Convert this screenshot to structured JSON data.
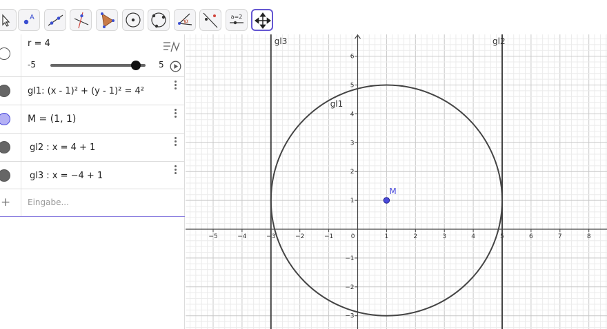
{
  "toolbar": {
    "tools": [
      {
        "name": "move-tool",
        "icon": "cursor-arrow-icon"
      },
      {
        "name": "point-tool",
        "icon": "point-icon",
        "glyph": "A"
      },
      {
        "name": "line-tool",
        "icon": "line-icon"
      },
      {
        "name": "perpendicular-line-tool",
        "icon": "perpendicular-line-icon"
      },
      {
        "name": "polygon-tool",
        "icon": "polygon-icon"
      },
      {
        "name": "circle-center-point-tool",
        "icon": "circle-center-icon"
      },
      {
        "name": "circle-three-points-tool",
        "icon": "circle-three-points-icon"
      },
      {
        "name": "angle-tool",
        "icon": "angle-icon",
        "glyph": "α"
      },
      {
        "name": "reflect-tool",
        "icon": "reflect-icon"
      },
      {
        "name": "slider-tool",
        "icon": "slider-icon",
        "glyph": "a=2"
      },
      {
        "name": "move-graphics-view-tool",
        "icon": "move-arrows-icon",
        "active": true
      }
    ]
  },
  "algebra": {
    "slider": {
      "label": "r = 4",
      "min_label": "-5",
      "max_label": "5",
      "min": -5,
      "max": 5,
      "value": 4
    },
    "rows": [
      {
        "text": "gl1: (x - 1)² + (y - 1)² = 4²",
        "color": "#666666"
      },
      {
        "text": "M = (1, 1)",
        "color": "#b4b0f5"
      },
      {
        "text": "gl2 : x = 4 + 1",
        "color": "#666666"
      },
      {
        "text": "gl3 : x = −4 + 1",
        "color": "#666666"
      }
    ],
    "input_placeholder": "Eingabe...",
    "input_plus": "+"
  },
  "graphics": {
    "x_ticks": [
      "−5",
      "−4",
      "−3",
      "−2",
      "−1",
      "0",
      "1",
      "2",
      "3",
      "4",
      "5",
      "6",
      "7",
      "8"
    ],
    "y_ticks": [
      "−3",
      "−2",
      "−1",
      "1",
      "2",
      "3",
      "4",
      "5",
      "6"
    ],
    "circle": {
      "label": "gl1",
      "cx": 1,
      "cy": 1,
      "r": 4
    },
    "point": {
      "label": "M",
      "x": 1,
      "y": 1,
      "color": "#4a4adb"
    },
    "line_gl2": {
      "label": "gl2",
      "x": 5
    },
    "line_gl3": {
      "label": "gl3",
      "x": -3
    }
  }
}
